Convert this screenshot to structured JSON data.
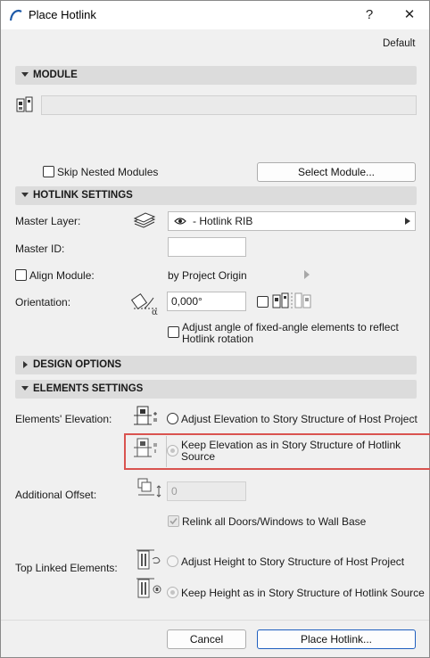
{
  "window": {
    "title": "Place Hotlink",
    "help": "?",
    "close": "✕"
  },
  "preset": "Default",
  "sections": {
    "module": "MODULE",
    "hotlink_settings": "HOTLINK SETTINGS",
    "design_options": "DESIGN OPTIONS",
    "elements_settings": "ELEMENTS SETTINGS"
  },
  "module": {
    "skip_nested": "Skip Nested Modules",
    "select_module": "Select Module..."
  },
  "hotlink": {
    "master_layer_label": "Master Layer:",
    "master_layer_value": "- Hotlink RIB",
    "master_id_label": "Master ID:",
    "master_id_value": "",
    "align_module_label": "Align Module:",
    "align_module_value": "by Project Origin",
    "orientation_label": "Orientation:",
    "orientation_value": "0,000°",
    "adjust_angle_line1": "Adjust angle of fixed-angle elements to reflect",
    "adjust_angle_line2": "Hotlink rotation"
  },
  "elements": {
    "elevation_label": "Elements' Elevation:",
    "adjust_elevation": "Adjust Elevation to Story Structure of Host Project",
    "keep_elevation_line1": "Keep Elevation as in Story Structure of Hotlink",
    "keep_elevation_line2": "Source",
    "additional_offset_label": "Additional Offset:",
    "additional_offset_value": "0",
    "relink": "Relink all Doors/Windows to Wall Base",
    "top_linked_label": "Top Linked Elements:",
    "adjust_height": "Adjust Height to Story Structure of Host Project",
    "keep_height": "Keep Height as in Story Structure of Hotlink Source"
  },
  "footer": {
    "cancel": "Cancel",
    "place": "Place Hotlink..."
  },
  "colors": {
    "highlight_border": "#d9534f",
    "section_bg": "#dcdcdc",
    "primary_border": "#1f5fbf"
  }
}
